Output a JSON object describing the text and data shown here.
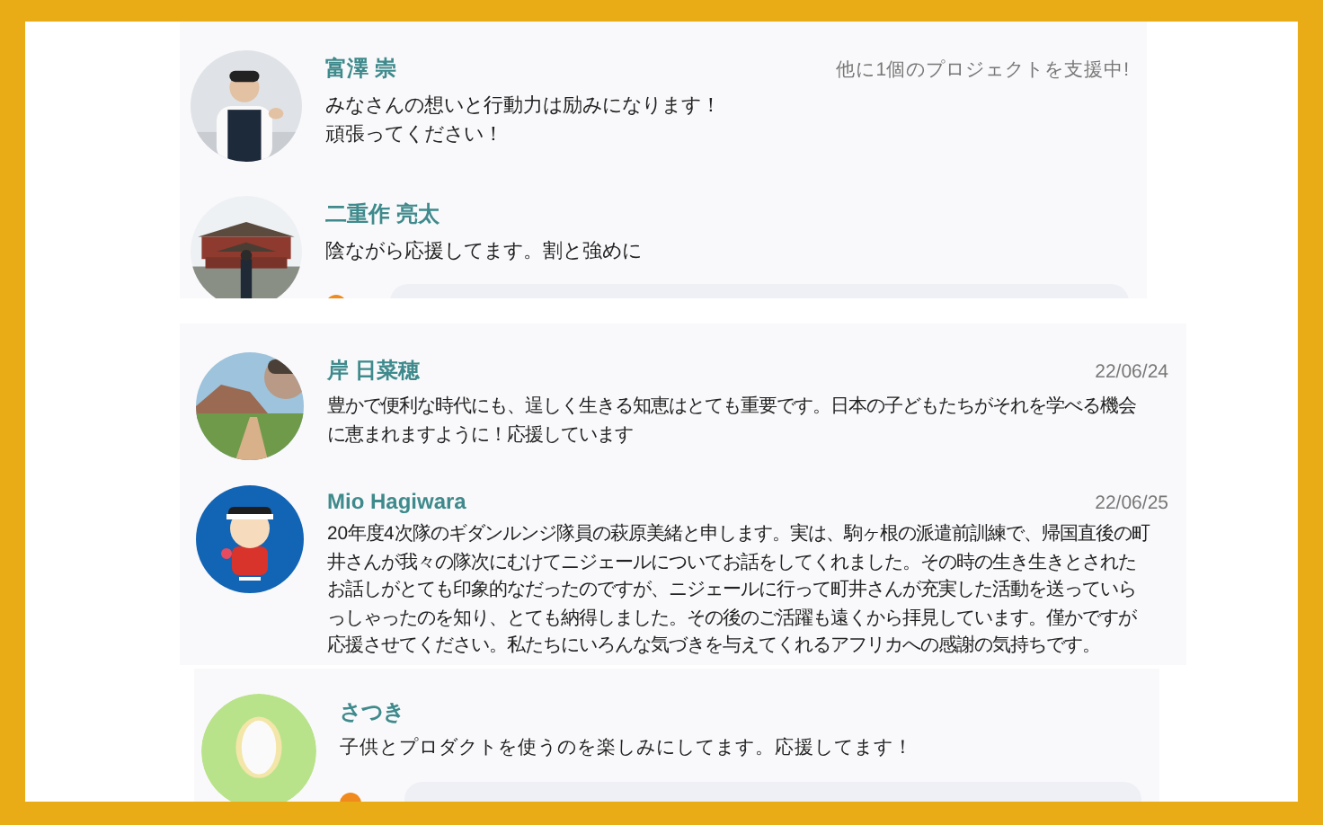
{
  "panels": [
    {
      "comments": [
        {
          "name": "富澤 崇",
          "note": "他に1個のプロジェクトを支援中!",
          "lines": [
            "みなさんの想いと行動力は励みになります！",
            "頑張ってください！"
          ],
          "has_reply": false
        },
        {
          "name": "二重作 亮太",
          "lines": [
            "陰ながら応援してます。割と強めに"
          ],
          "has_reply": true
        }
      ]
    },
    {
      "comments": [
        {
          "name": "岸 日菜穂",
          "note": "22/06/24",
          "lines": [
            "豊かで便利な時代にも、逞しく生きる知恵はとても重要です。日本の子どもたちがそれを学べる機会",
            "に恵まれますように！応援しています"
          ],
          "has_reply": false
        },
        {
          "name": "Mio Hagiwara",
          "note": "22/06/25",
          "lines": [
            "20年度4次隊のギダンルンジ隊員の萩原美緒と申します。実は、駒ヶ根の派遣前訓練で、帰国直後の町",
            "井さんが我々の隊次にむけてニジェールについてお話をしてくれました。その時の生き生きとされた",
            "お話しがとても印象的なだったのですが、ニジェールに行って町井さんが充実した活動を送っていら",
            "っしゃったのを知り、とても納得しました。その後のご活躍も遠くから拝見しています。僅かですが",
            "応援させてください。私たちにいろんな気づきを与えてくれるアフリカへの感謝の気持ちです。"
          ],
          "has_reply": false
        }
      ]
    },
    {
      "comments": [
        {
          "name": "さつき",
          "lines": [
            "子供とプロダクトを使うのを楽しみにしてます。応援してます！"
          ],
          "has_reply": true
        }
      ]
    }
  ]
}
